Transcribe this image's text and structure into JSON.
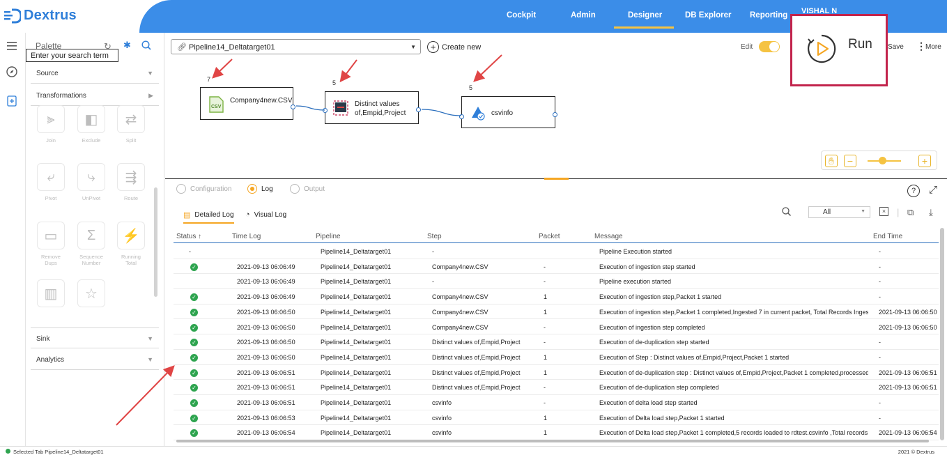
{
  "header": {
    "logo_text": "Dextrus",
    "nav": [
      "Cockpit",
      "Admin",
      "Designer",
      "DB Explorer",
      "Reporting"
    ],
    "active_nav": "Designer",
    "user_text": "VISHAL N"
  },
  "palette": {
    "title": "Palette",
    "search_tooltip": "Enter your search term",
    "sections": [
      "Source",
      "Transformations",
      "Sink",
      "Analytics"
    ],
    "tools": [
      "Join",
      "Exclude",
      "Split",
      "Pivot",
      "UnPivot",
      "Route",
      "Remove Dups",
      "Sequence Number",
      "Running Total",
      "",
      ""
    ]
  },
  "toolbar": {
    "pipeline_name": "Pipeline14_Deltatarget01",
    "create_new": "Create new",
    "edit_label": "Edit",
    "save_label": "Save",
    "more_label": "More",
    "run_label": "Run"
  },
  "nodes": [
    {
      "count": "7",
      "label": "Company4new.CSV"
    },
    {
      "count": "5",
      "label": "Distinct values of,Empid,Project"
    },
    {
      "count": "5",
      "label": "csvinfo"
    }
  ],
  "panel": {
    "tabs": [
      "Configuration",
      "Log",
      "Output"
    ],
    "active_tab": "Log",
    "sub_tabs": [
      "Detailed Log",
      "Visual Log"
    ],
    "filter_value": "All"
  },
  "table": {
    "headers": [
      "Status",
      "Time Log",
      "Pipeline",
      "Step",
      "Packet",
      "Message",
      "End Time"
    ],
    "rows": [
      {
        "ok": false,
        "status": "-",
        "time": "",
        "pipeline": "Pipeline14_Deltatarget01",
        "step": "-",
        "packet": "",
        "message": "Pipeline Execution started",
        "end": "-"
      },
      {
        "ok": true,
        "status": "",
        "time": "2021-09-13 06:06:49",
        "pipeline": "Pipeline14_Deltatarget01",
        "step": "Company4new.CSV",
        "packet": "-",
        "message": "Execution of ingestion step started",
        "end": "-"
      },
      {
        "ok": false,
        "status": "",
        "time": "2021-09-13 06:06:49",
        "pipeline": "Pipeline14_Deltatarget01",
        "step": "-",
        "packet": "-",
        "message": "Pipeline execution started",
        "end": "-"
      },
      {
        "ok": true,
        "status": "",
        "time": "2021-09-13 06:06:49",
        "pipeline": "Pipeline14_Deltatarget01",
        "step": "Company4new.CSV",
        "packet": "1",
        "message": "Execution of ingestion step,Packet 1 started",
        "end": "-"
      },
      {
        "ok": true,
        "status": "",
        "time": "2021-09-13 06:06:50",
        "pipeline": "Pipeline14_Deltatarget01",
        "step": "Company4new.CSV",
        "packet": "1",
        "message": "Execution of ingestion step,Packet 1 completed,Ingested 7 in current packet, Total Records Inges...",
        "end": "2021-09-13 06:06:50"
      },
      {
        "ok": true,
        "status": "",
        "time": "2021-09-13 06:06:50",
        "pipeline": "Pipeline14_Deltatarget01",
        "step": "Company4new.CSV",
        "packet": "-",
        "message": "Execution of ingestion step completed",
        "end": "2021-09-13 06:06:50"
      },
      {
        "ok": true,
        "status": "",
        "time": "2021-09-13 06:06:50",
        "pipeline": "Pipeline14_Deltatarget01",
        "step": "Distinct values of,Empid,Project",
        "packet": "-",
        "message": "Execution of de-duplication step started",
        "end": "-"
      },
      {
        "ok": true,
        "status": "",
        "time": "2021-09-13 06:06:50",
        "pipeline": "Pipeline14_Deltatarget01",
        "step": "Distinct values of,Empid,Project",
        "packet": "1",
        "message": "Execution of Step : Distinct values of,Empid,Project,Packet 1 started",
        "end": "-"
      },
      {
        "ok": true,
        "status": "",
        "time": "2021-09-13 06:06:51",
        "pipeline": "Pipeline14_Deltatarget01",
        "step": "Distinct values of,Empid,Project",
        "packet": "1",
        "message": "Execution of de-duplication step : Distinct values of,Empid,Project,Packet 1 completed,processed...",
        "end": "2021-09-13 06:06:51"
      },
      {
        "ok": true,
        "status": "",
        "time": "2021-09-13 06:06:51",
        "pipeline": "Pipeline14_Deltatarget01",
        "step": "Distinct values of,Empid,Project",
        "packet": "-",
        "message": "Execution of de-duplication step completed",
        "end": "2021-09-13 06:06:51"
      },
      {
        "ok": true,
        "status": "",
        "time": "2021-09-13 06:06:51",
        "pipeline": "Pipeline14_Deltatarget01",
        "step": "csvinfo",
        "packet": "-",
        "message": "Execution of delta load step started",
        "end": "-"
      },
      {
        "ok": true,
        "status": "",
        "time": "2021-09-13 06:06:53",
        "pipeline": "Pipeline14_Deltatarget01",
        "step": "csvinfo",
        "packet": "1",
        "message": "Execution of Delta load step,Packet 1 started",
        "end": "-"
      },
      {
        "ok": true,
        "status": "",
        "time": "2021-09-13 06:06:54",
        "pipeline": "Pipeline14_Deltatarget01",
        "step": "csvinfo",
        "packet": "1",
        "message": "Execution of Delta load step,Packet 1 completed,5 records loaded to rdtest.csvinfo ,Total records...",
        "end": "2021-09-13 06:06:54"
      }
    ]
  },
  "status_bar": {
    "left": "Selected Tab Pipeline14_Deltatarget01",
    "right": "2021 © Dextrus"
  },
  "colors": {
    "header_blue": "#3b8de8",
    "accent_yellow": "#f5c342",
    "accent_orange": "#f5a623",
    "run_box_border": "#c2244c",
    "success_green": "#2ea44f",
    "annotation_arrow": "#e04545"
  }
}
